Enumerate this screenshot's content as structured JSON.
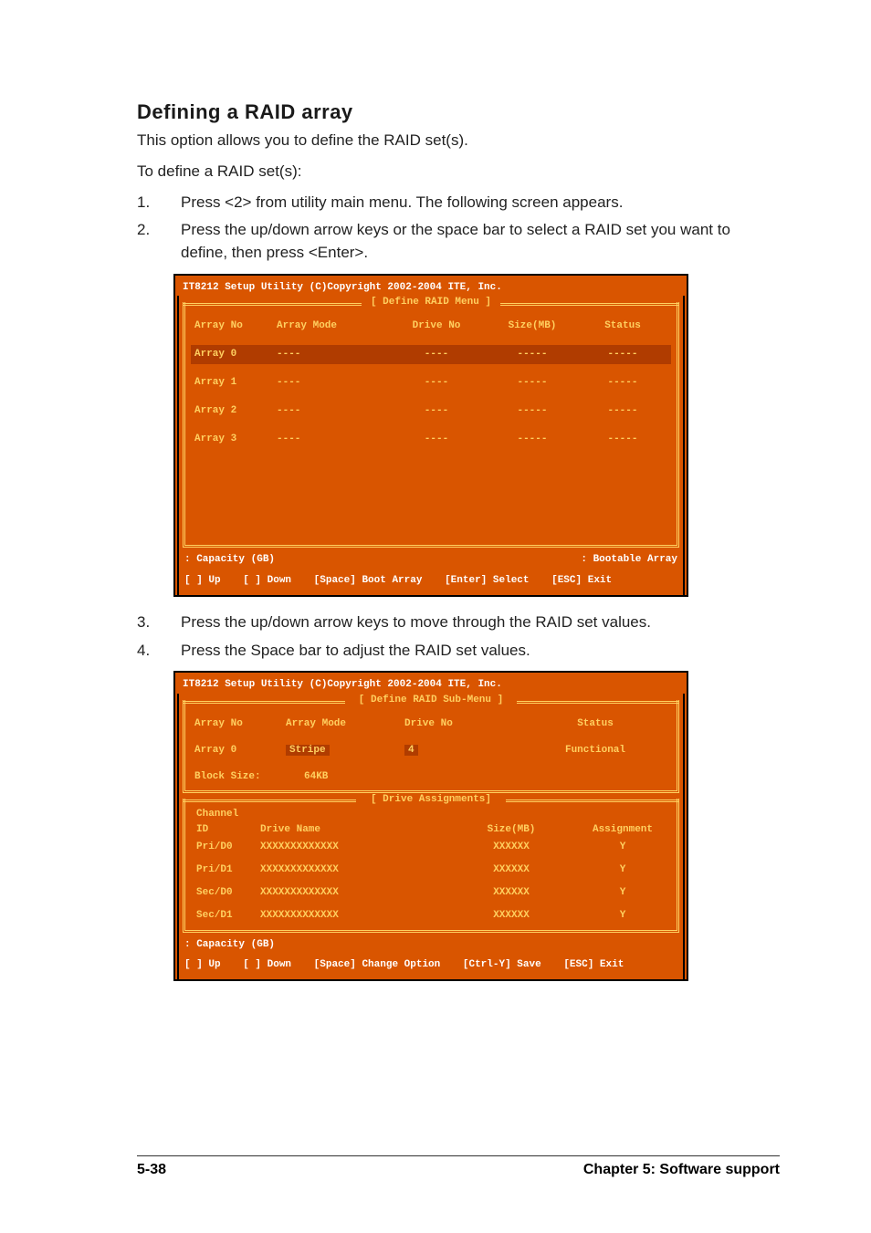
{
  "heading": "Defining a RAID array",
  "intro1": "This option allows you to define the RAID set(s).",
  "intro2": "To define a RAID set(s):",
  "steps_a": [
    {
      "n": "1.",
      "t": "Press <2> from utility main menu. The following screen appears."
    },
    {
      "n": "2.",
      "t": "Press the up/down arrow keys or the space bar to select a RAID set you want to define, then press <Enter>."
    }
  ],
  "steps_b": [
    {
      "n": "3.",
      "t": "Press the up/down arrow keys to move through the RAID set values."
    },
    {
      "n": "4.",
      "t": "Press the Space bar to adjust the RAID set values."
    }
  ],
  "bios1": {
    "title": "IT8212 Setup Utility (C)Copyright 2002-2004 ITE, Inc.",
    "frame": "[ Define RAID Menu ]",
    "headers": {
      "c1": "Array No",
      "c2": "Array Mode",
      "c3": "Drive No",
      "c4": "Size(MB)",
      "c5": "Status"
    },
    "rows": [
      {
        "c1": "Array 0",
        "c2": "----",
        "c3": "----",
        "c4": "-----",
        "c5": "-----",
        "sel": true
      },
      {
        "c1": "Array 1",
        "c2": "----",
        "c3": "----",
        "c4": "-----",
        "c5": "-----",
        "sel": false
      },
      {
        "c1": "Array 2",
        "c2": "----",
        "c3": "----",
        "c4": "-----",
        "c5": "-----",
        "sel": false
      },
      {
        "c1": "Array 3",
        "c2": "----",
        "c3": "----",
        "c4": "-----",
        "c5": "-----",
        "sel": false
      }
    ],
    "foot_top_left": " : Capacity (GB)",
    "foot_top_right": " : Bootable Array",
    "foot_bottom": {
      "a": "[ ] Up",
      "b": "[ ] Down",
      "c": "[Space] Boot Array",
      "d": "[Enter] Select",
      "e": "[ESC] Exit"
    }
  },
  "bios2": {
    "title": "IT8212 Setup Utility (C)Copyright 2002-2004 ITE, Inc.",
    "frame1": "[ Define RAID Sub-Menu ]",
    "headers": {
      "b1": "Array No",
      "b2": "Array Mode",
      "b3": "Drive No",
      "b4": "Status"
    },
    "row0": {
      "b1": "Array 0",
      "b2": "Stripe",
      "b3": "4",
      "b4": "Functional"
    },
    "block_label": "Block Size:",
    "block_value": "64KB",
    "frame2": "[ Drive Assignments]",
    "dheaders": {
      "hline1": "Channel",
      "d1": "ID",
      "d2": "Drive Name",
      "d3": "Size(MB)",
      "d4": "Assignment"
    },
    "drows": [
      {
        "d1": "Pri/D0",
        "d2": "XXXXXXXXXXXXX",
        "d3": "XXXXXX",
        "d4": "Y"
      },
      {
        "d1": "Pri/D1",
        "d2": "XXXXXXXXXXXXX",
        "d3": "XXXXXX",
        "d4": "Y"
      },
      {
        "d1": "Sec/D0",
        "d2": "XXXXXXXXXXXXX",
        "d3": "XXXXXX",
        "d4": "Y"
      },
      {
        "d1": "Sec/D1",
        "d2": "XXXXXXXXXXXXX",
        "d3": "XXXXXX",
        "d4": "Y"
      }
    ],
    "foot_top_left": " : Capacity (GB)",
    "foot_bottom": {
      "a": "[ ] Up",
      "b": "[ ] Down",
      "c": "[Space] Change Option",
      "d": "[Ctrl-Y] Save",
      "e": "[ESC] Exit"
    }
  },
  "page_footer": {
    "left": "5-38",
    "right": "Chapter 5: Software support"
  }
}
